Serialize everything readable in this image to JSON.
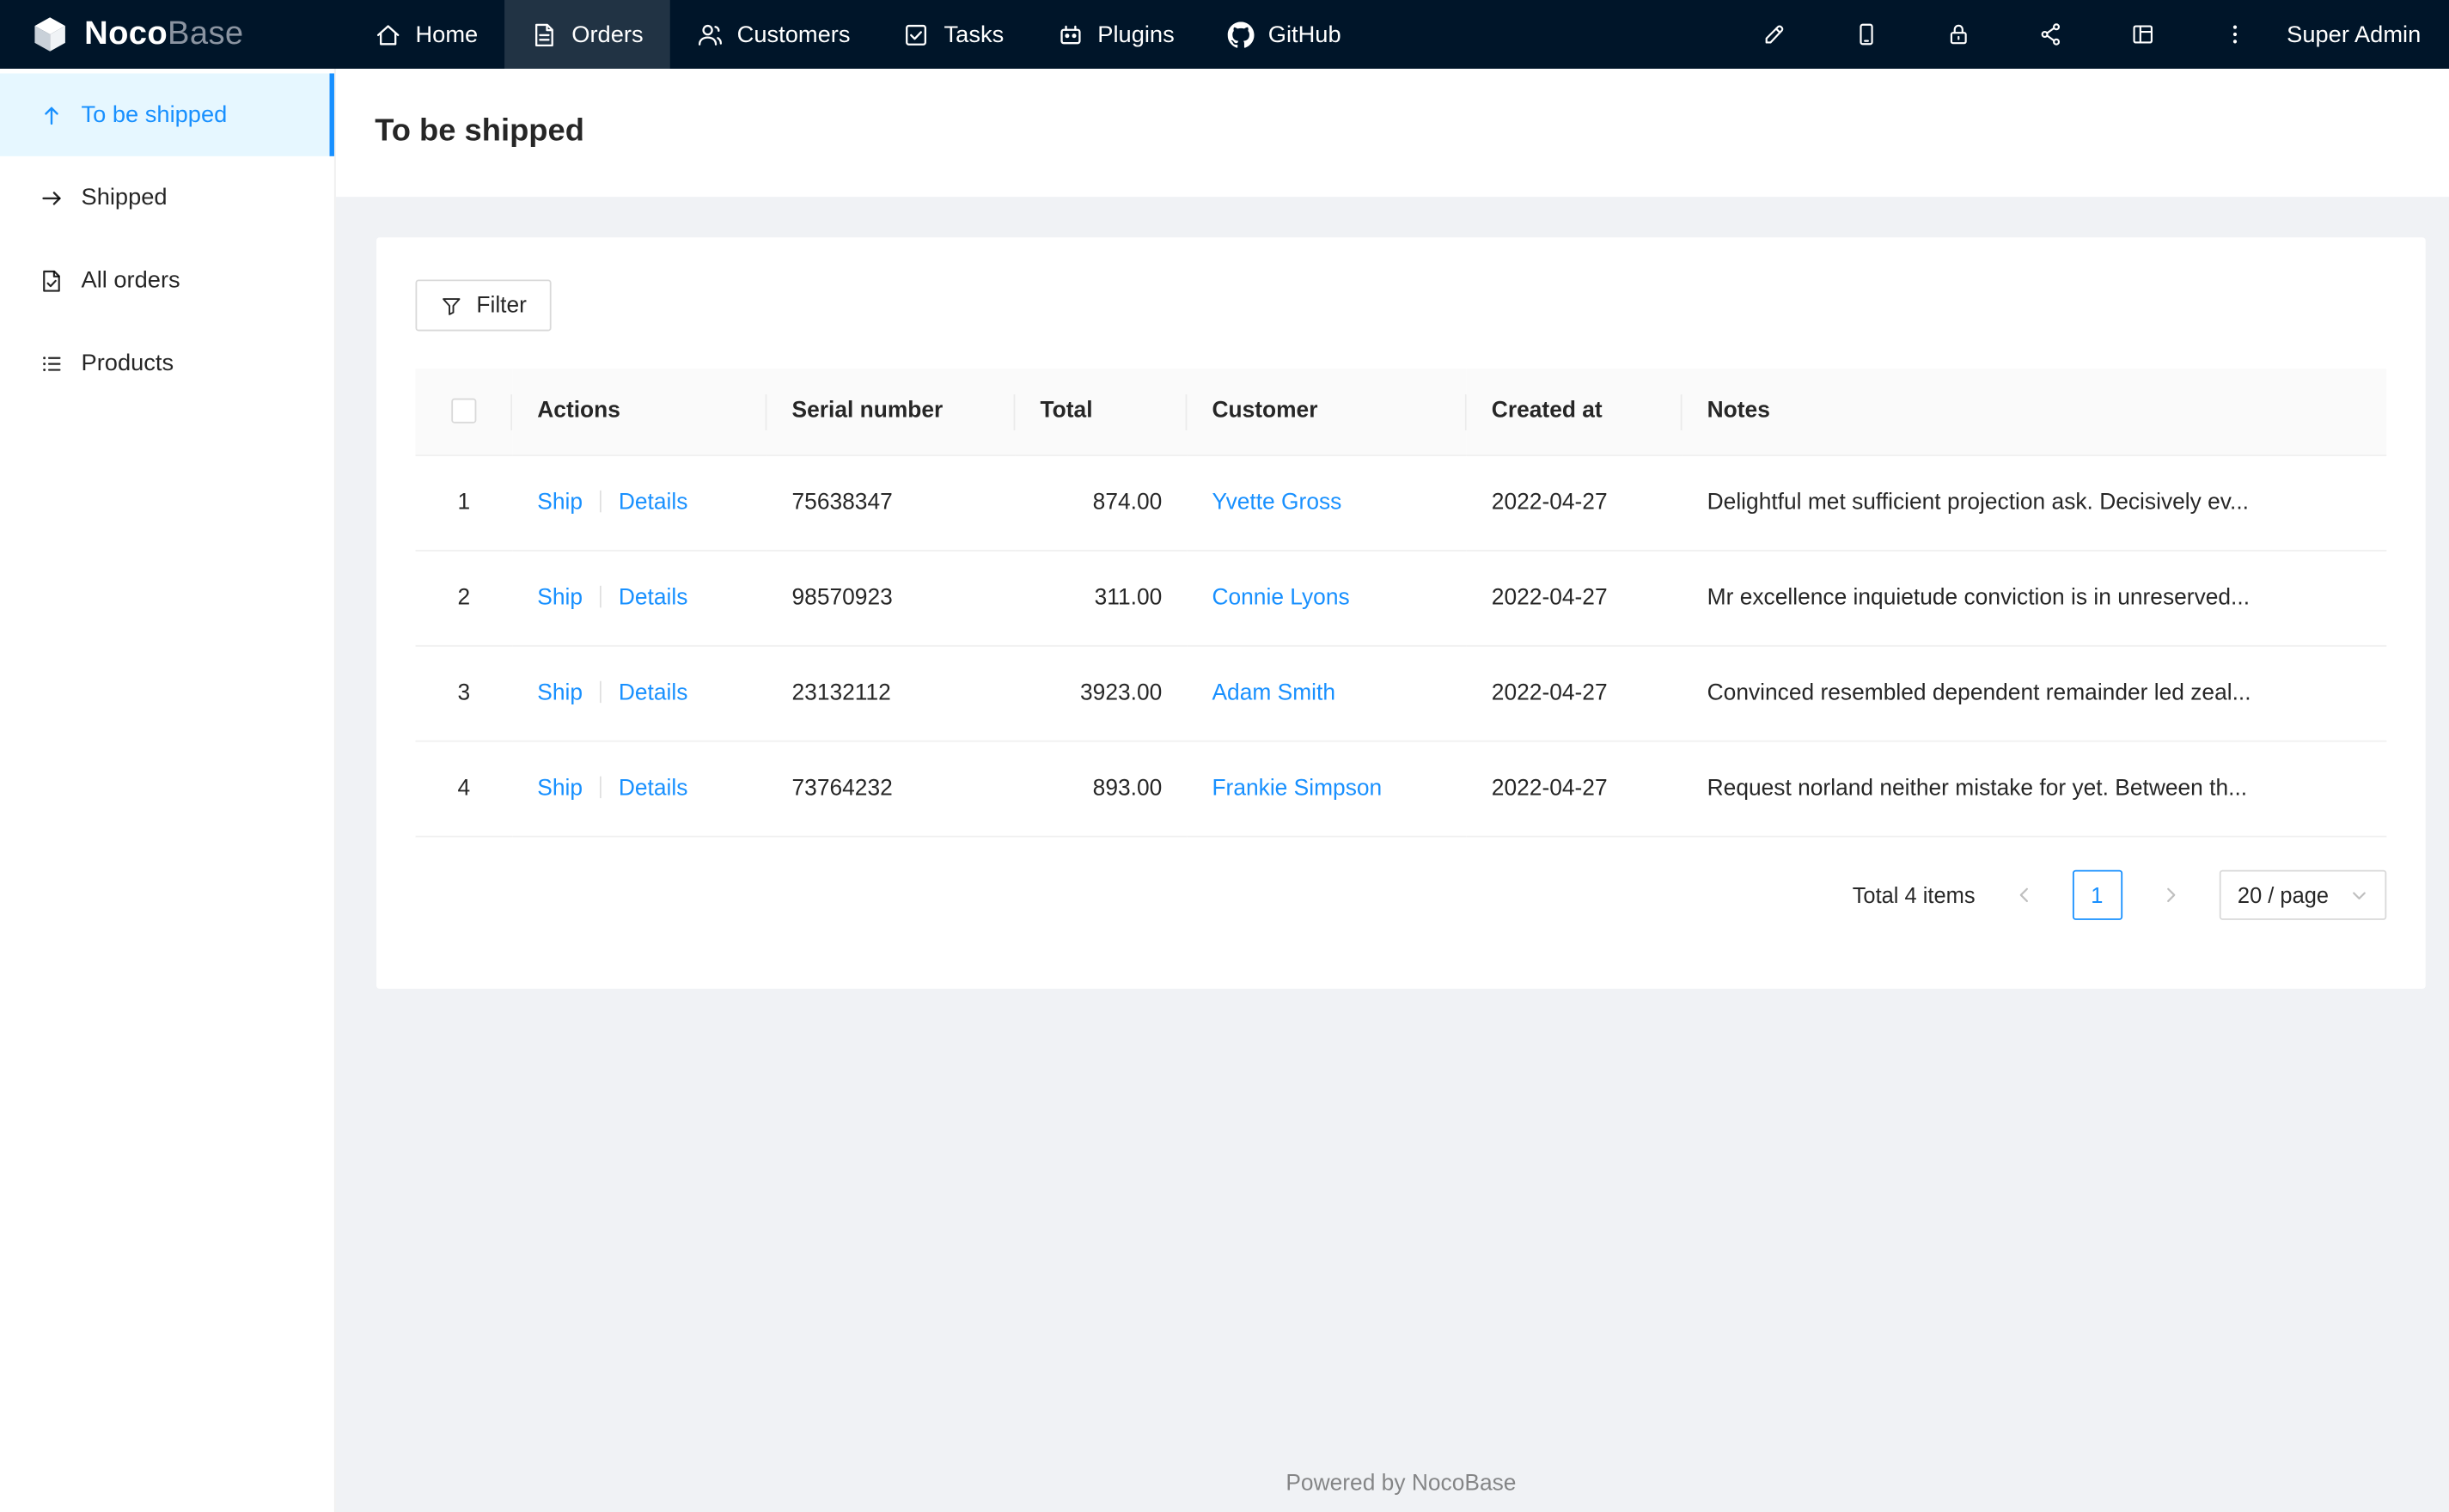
{
  "colors": {
    "accent": "#1890ff",
    "navbar_bg": "#001529",
    "sidebar_active_bg": "#e6f7ff",
    "content_bg": "#f0f2f5",
    "link": "#1890ff"
  },
  "navbar": {
    "logo_bold": "Noco",
    "logo_light": "Base",
    "items": [
      {
        "label": "Home",
        "icon": "home-icon",
        "active": false
      },
      {
        "label": "Orders",
        "icon": "orders-icon",
        "active": true
      },
      {
        "label": "Customers",
        "icon": "customers-icon",
        "active": false
      },
      {
        "label": "Tasks",
        "icon": "tasks-icon",
        "active": false
      },
      {
        "label": "Plugins",
        "icon": "plugins-icon",
        "active": false
      },
      {
        "label": "GitHub",
        "icon": "github-icon",
        "active": false
      }
    ],
    "right_icons": [
      "highlighter-icon",
      "mobile-icon",
      "lock-icon",
      "share-nodes-icon",
      "layout-icon",
      "more-icon"
    ],
    "user": "Super Admin"
  },
  "sidebar": {
    "items": [
      {
        "label": "To be shipped",
        "icon": "arrow-up-icon",
        "active": true
      },
      {
        "label": "Shipped",
        "icon": "arrow-right-icon",
        "active": false
      },
      {
        "label": "All orders",
        "icon": "file-check-icon",
        "active": false
      },
      {
        "label": "Products",
        "icon": "list-icon",
        "active": false
      }
    ]
  },
  "page": {
    "title": "To be shipped"
  },
  "toolbar": {
    "filter_label": "Filter"
  },
  "table": {
    "headers": [
      "Actions",
      "Serial number",
      "Total",
      "Customer",
      "Created at",
      "Notes"
    ],
    "actions": {
      "ship": "Ship",
      "details": "Details"
    },
    "rows": [
      {
        "index": "1",
        "serial_number": "75638347",
        "total": "874.00",
        "customer": "Yvette Gross",
        "created_at": "2022-04-27",
        "notes": "Delightful met sufficient projection ask. Decisively ev..."
      },
      {
        "index": "2",
        "serial_number": "98570923",
        "total": "311.00",
        "customer": "Connie Lyons",
        "created_at": "2022-04-27",
        "notes": "Mr excellence inquietude conviction is in unreserved..."
      },
      {
        "index": "3",
        "serial_number": "23132112",
        "total": "3923.00",
        "customer": "Adam Smith",
        "created_at": "2022-04-27",
        "notes": "Convinced resembled dependent remainder led zeal..."
      },
      {
        "index": "4",
        "serial_number": "73764232",
        "total": "893.00",
        "customer": "Frankie Simpson",
        "created_at": "2022-04-27",
        "notes": "Request norland neither mistake for yet. Between th..."
      }
    ]
  },
  "pagination": {
    "total_text": "Total 4 items",
    "current_page": "1",
    "page_size": "20 / page"
  },
  "footer": {
    "text": "Powered by NocoBase"
  }
}
